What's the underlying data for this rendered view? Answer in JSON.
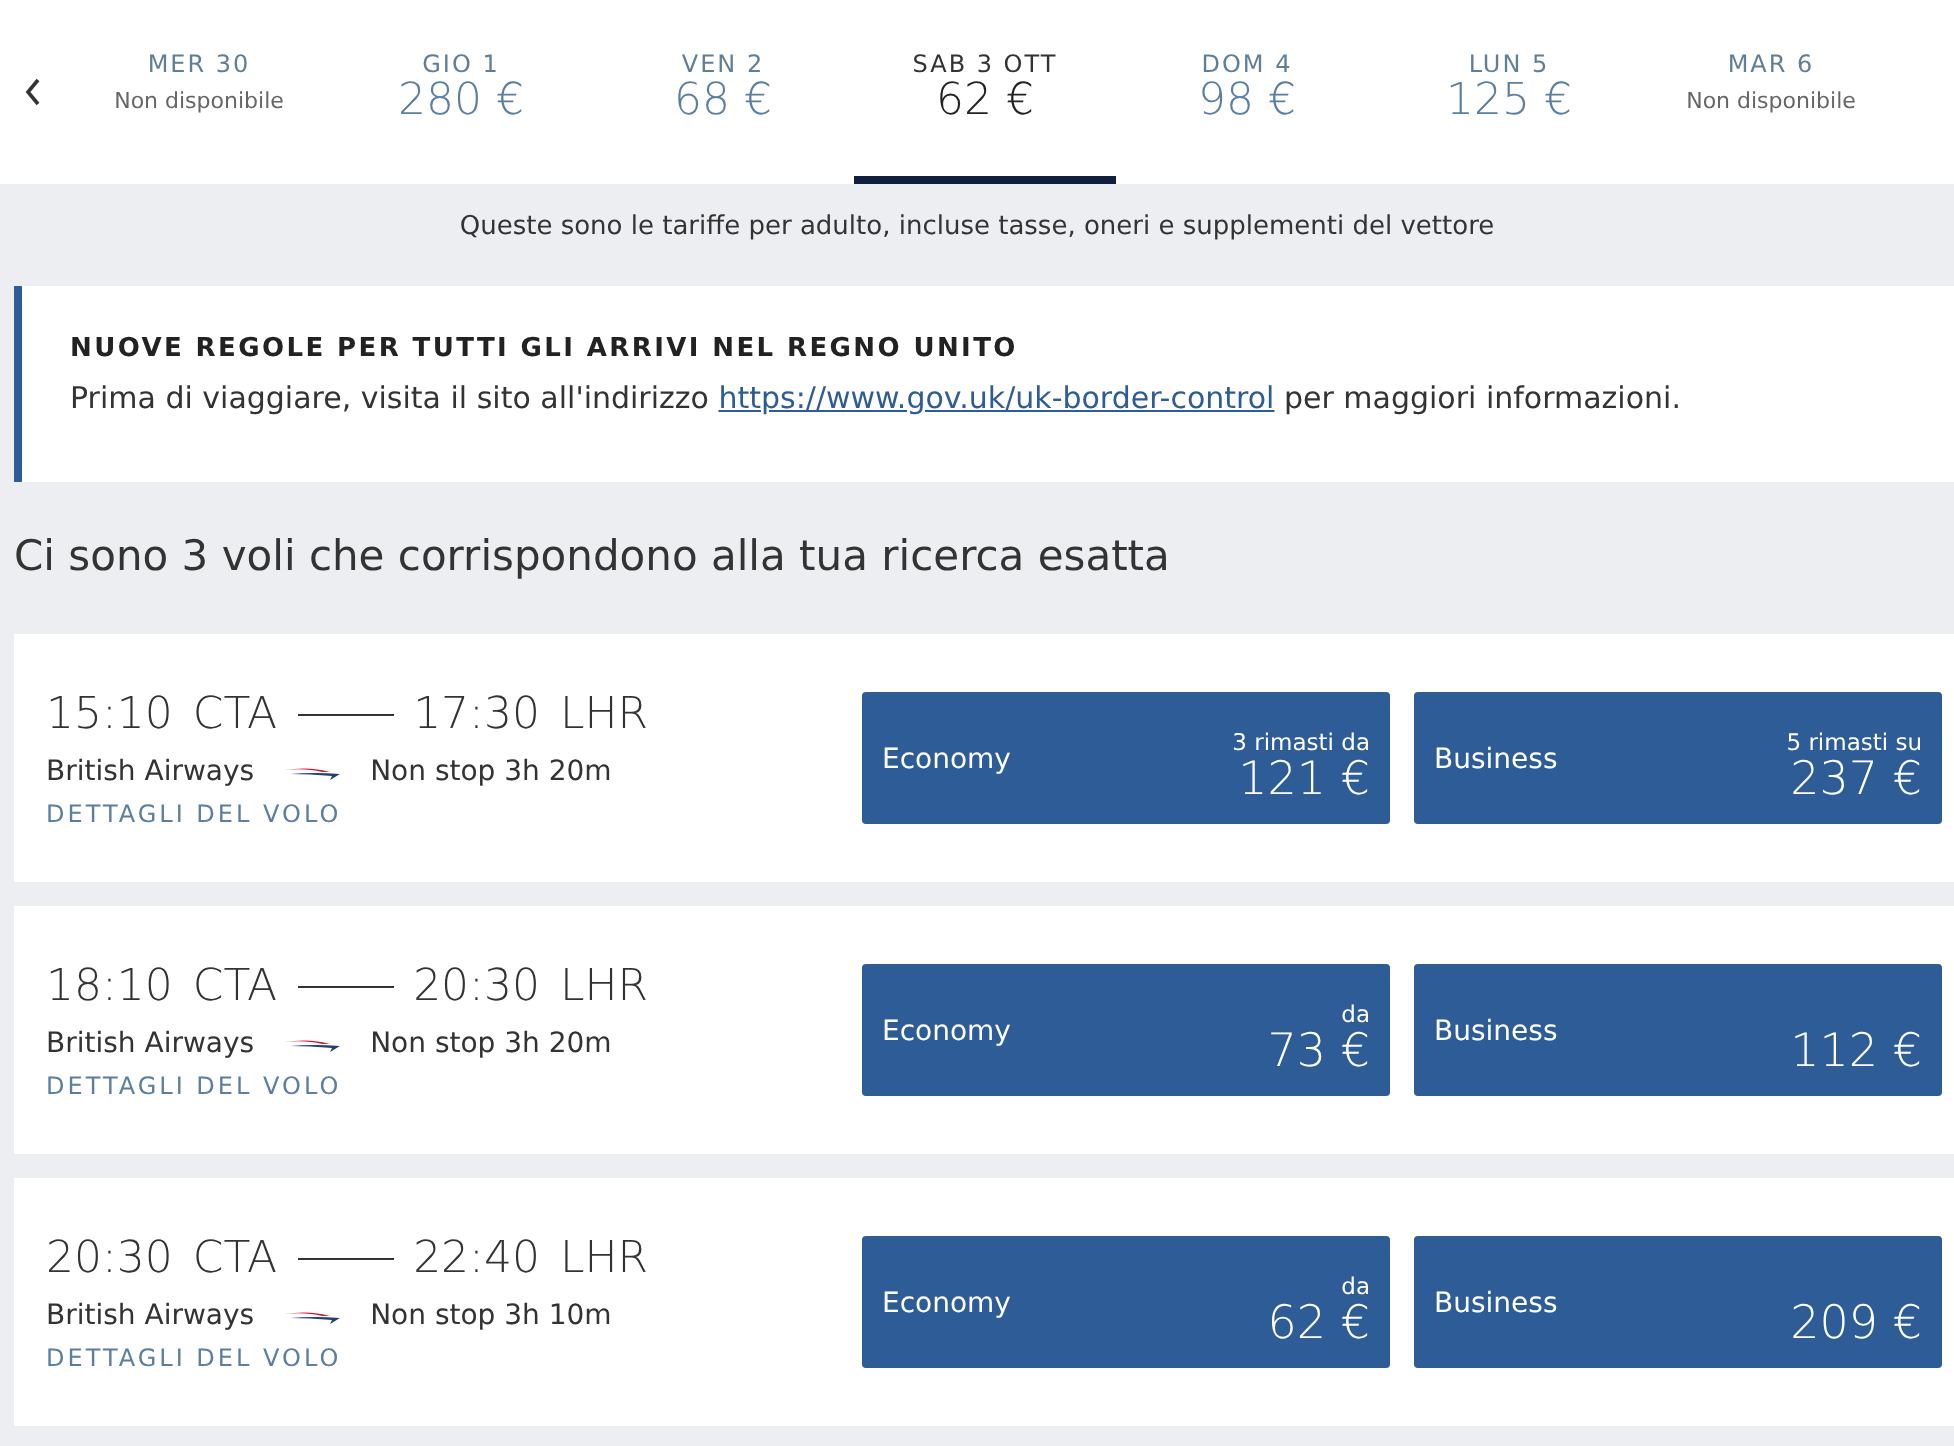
{
  "dates": [
    {
      "day": "MER 30",
      "status": "Non disponibile",
      "selected": false
    },
    {
      "day": "GIO 1",
      "price": "280 €",
      "selected": false
    },
    {
      "day": "VEN 2",
      "price": "68 €",
      "selected": false
    },
    {
      "day": "SAB 3 OTT",
      "price": "62 €",
      "selected": true
    },
    {
      "day": "DOM 4",
      "price": "98 €",
      "selected": false
    },
    {
      "day": "LUN 5",
      "price": "125 €",
      "selected": false
    },
    {
      "day": "MAR 6",
      "status": "Non disponibile",
      "selected": false
    }
  ],
  "fare_note": "Queste sono le tariffe per adulto, incluse tasse, oneri e supplementi del vettore",
  "notice": {
    "title": "NUOVE REGOLE PER TUTTI GLI ARRIVI NEL REGNO UNITO",
    "text_before": "Prima di viaggiare, visita il sito all'indirizzo",
    "link": "https://www.gov.uk/uk-border-control",
    "text_after": "per maggiori informazioni."
  },
  "results_heading": "Ci sono 3 voli che corrispondono alla tua ricerca esatta",
  "flights": [
    {
      "depart_time": "15:10",
      "depart_airport": "CTA",
      "arrive_time": "17:30",
      "arrive_airport": "LHR",
      "airline": "British Airways",
      "duration": "Non stop 3h 20m",
      "details_link": "DETTAGLI DEL VOLO",
      "fares": [
        {
          "cabin": "Economy",
          "note": "3 rimasti da",
          "price": "121 €"
        },
        {
          "cabin": "Business",
          "note": "5 rimasti su",
          "price": "237 €"
        }
      ]
    },
    {
      "depart_time": "18:10",
      "depart_airport": "CTA",
      "arrive_time": "20:30",
      "arrive_airport": "LHR",
      "airline": "British Airways",
      "duration": "Non stop 3h 20m",
      "details_link": "DETTAGLI DEL VOLO",
      "fares": [
        {
          "cabin": "Economy",
          "note": "da",
          "price": "73 €"
        },
        {
          "cabin": "Business",
          "price": "112 €"
        }
      ]
    },
    {
      "depart_time": "20:30",
      "depart_airport": "CTA",
      "arrive_time": "22:40",
      "arrive_airport": "LHR",
      "airline": "British Airways",
      "duration": "Non stop 3h 10m",
      "details_link": "DETTAGLI DEL VOLO",
      "fares": [
        {
          "cabin": "Economy",
          "note": "da",
          "price": "62 €"
        },
        {
          "cabin": "Business",
          "price": "209 €"
        }
      ]
    }
  ]
}
